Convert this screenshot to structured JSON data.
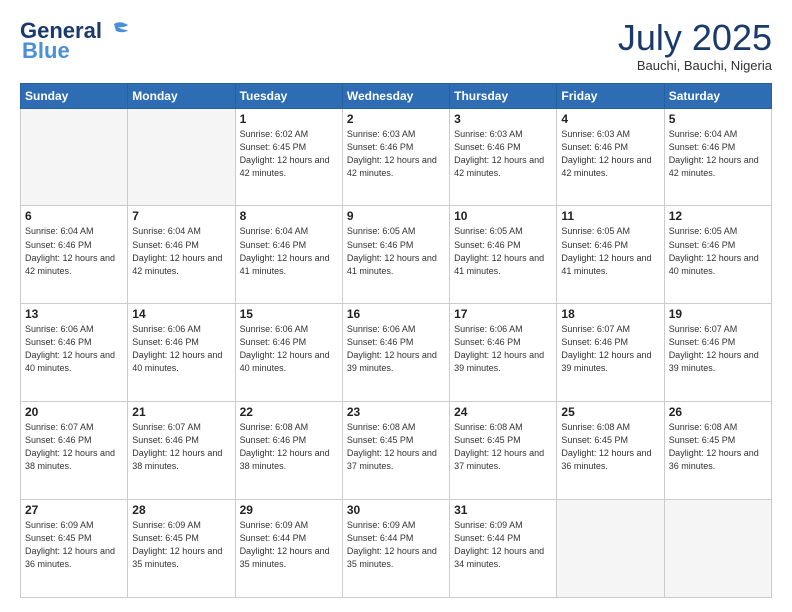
{
  "header": {
    "logo_general": "General",
    "logo_blue": "Blue",
    "month": "July 2025",
    "location": "Bauchi, Bauchi, Nigeria"
  },
  "days_of_week": [
    "Sunday",
    "Monday",
    "Tuesday",
    "Wednesday",
    "Thursday",
    "Friday",
    "Saturday"
  ],
  "weeks": [
    [
      {
        "day": "",
        "sunrise": "",
        "sunset": "",
        "daylight": ""
      },
      {
        "day": "",
        "sunrise": "",
        "sunset": "",
        "daylight": ""
      },
      {
        "day": "1",
        "sunrise": "Sunrise: 6:02 AM",
        "sunset": "Sunset: 6:45 PM",
        "daylight": "Daylight: 12 hours and 42 minutes."
      },
      {
        "day": "2",
        "sunrise": "Sunrise: 6:03 AM",
        "sunset": "Sunset: 6:46 PM",
        "daylight": "Daylight: 12 hours and 42 minutes."
      },
      {
        "day": "3",
        "sunrise": "Sunrise: 6:03 AM",
        "sunset": "Sunset: 6:46 PM",
        "daylight": "Daylight: 12 hours and 42 minutes."
      },
      {
        "day": "4",
        "sunrise": "Sunrise: 6:03 AM",
        "sunset": "Sunset: 6:46 PM",
        "daylight": "Daylight: 12 hours and 42 minutes."
      },
      {
        "day": "5",
        "sunrise": "Sunrise: 6:04 AM",
        "sunset": "Sunset: 6:46 PM",
        "daylight": "Daylight: 12 hours and 42 minutes."
      }
    ],
    [
      {
        "day": "6",
        "sunrise": "Sunrise: 6:04 AM",
        "sunset": "Sunset: 6:46 PM",
        "daylight": "Daylight: 12 hours and 42 minutes."
      },
      {
        "day": "7",
        "sunrise": "Sunrise: 6:04 AM",
        "sunset": "Sunset: 6:46 PM",
        "daylight": "Daylight: 12 hours and 42 minutes."
      },
      {
        "day": "8",
        "sunrise": "Sunrise: 6:04 AM",
        "sunset": "Sunset: 6:46 PM",
        "daylight": "Daylight: 12 hours and 41 minutes."
      },
      {
        "day": "9",
        "sunrise": "Sunrise: 6:05 AM",
        "sunset": "Sunset: 6:46 PM",
        "daylight": "Daylight: 12 hours and 41 minutes."
      },
      {
        "day": "10",
        "sunrise": "Sunrise: 6:05 AM",
        "sunset": "Sunset: 6:46 PM",
        "daylight": "Daylight: 12 hours and 41 minutes."
      },
      {
        "day": "11",
        "sunrise": "Sunrise: 6:05 AM",
        "sunset": "Sunset: 6:46 PM",
        "daylight": "Daylight: 12 hours and 41 minutes."
      },
      {
        "day": "12",
        "sunrise": "Sunrise: 6:05 AM",
        "sunset": "Sunset: 6:46 PM",
        "daylight": "Daylight: 12 hours and 40 minutes."
      }
    ],
    [
      {
        "day": "13",
        "sunrise": "Sunrise: 6:06 AM",
        "sunset": "Sunset: 6:46 PM",
        "daylight": "Daylight: 12 hours and 40 minutes."
      },
      {
        "day": "14",
        "sunrise": "Sunrise: 6:06 AM",
        "sunset": "Sunset: 6:46 PM",
        "daylight": "Daylight: 12 hours and 40 minutes."
      },
      {
        "day": "15",
        "sunrise": "Sunrise: 6:06 AM",
        "sunset": "Sunset: 6:46 PM",
        "daylight": "Daylight: 12 hours and 40 minutes."
      },
      {
        "day": "16",
        "sunrise": "Sunrise: 6:06 AM",
        "sunset": "Sunset: 6:46 PM",
        "daylight": "Daylight: 12 hours and 39 minutes."
      },
      {
        "day": "17",
        "sunrise": "Sunrise: 6:06 AM",
        "sunset": "Sunset: 6:46 PM",
        "daylight": "Daylight: 12 hours and 39 minutes."
      },
      {
        "day": "18",
        "sunrise": "Sunrise: 6:07 AM",
        "sunset": "Sunset: 6:46 PM",
        "daylight": "Daylight: 12 hours and 39 minutes."
      },
      {
        "day": "19",
        "sunrise": "Sunrise: 6:07 AM",
        "sunset": "Sunset: 6:46 PM",
        "daylight": "Daylight: 12 hours and 39 minutes."
      }
    ],
    [
      {
        "day": "20",
        "sunrise": "Sunrise: 6:07 AM",
        "sunset": "Sunset: 6:46 PM",
        "daylight": "Daylight: 12 hours and 38 minutes."
      },
      {
        "day": "21",
        "sunrise": "Sunrise: 6:07 AM",
        "sunset": "Sunset: 6:46 PM",
        "daylight": "Daylight: 12 hours and 38 minutes."
      },
      {
        "day": "22",
        "sunrise": "Sunrise: 6:08 AM",
        "sunset": "Sunset: 6:46 PM",
        "daylight": "Daylight: 12 hours and 38 minutes."
      },
      {
        "day": "23",
        "sunrise": "Sunrise: 6:08 AM",
        "sunset": "Sunset: 6:45 PM",
        "daylight": "Daylight: 12 hours and 37 minutes."
      },
      {
        "day": "24",
        "sunrise": "Sunrise: 6:08 AM",
        "sunset": "Sunset: 6:45 PM",
        "daylight": "Daylight: 12 hours and 37 minutes."
      },
      {
        "day": "25",
        "sunrise": "Sunrise: 6:08 AM",
        "sunset": "Sunset: 6:45 PM",
        "daylight": "Daylight: 12 hours and 36 minutes."
      },
      {
        "day": "26",
        "sunrise": "Sunrise: 6:08 AM",
        "sunset": "Sunset: 6:45 PM",
        "daylight": "Daylight: 12 hours and 36 minutes."
      }
    ],
    [
      {
        "day": "27",
        "sunrise": "Sunrise: 6:09 AM",
        "sunset": "Sunset: 6:45 PM",
        "daylight": "Daylight: 12 hours and 36 minutes."
      },
      {
        "day": "28",
        "sunrise": "Sunrise: 6:09 AM",
        "sunset": "Sunset: 6:45 PM",
        "daylight": "Daylight: 12 hours and 35 minutes."
      },
      {
        "day": "29",
        "sunrise": "Sunrise: 6:09 AM",
        "sunset": "Sunset: 6:44 PM",
        "daylight": "Daylight: 12 hours and 35 minutes."
      },
      {
        "day": "30",
        "sunrise": "Sunrise: 6:09 AM",
        "sunset": "Sunset: 6:44 PM",
        "daylight": "Daylight: 12 hours and 35 minutes."
      },
      {
        "day": "31",
        "sunrise": "Sunrise: 6:09 AM",
        "sunset": "Sunset: 6:44 PM",
        "daylight": "Daylight: 12 hours and 34 minutes."
      },
      {
        "day": "",
        "sunrise": "",
        "sunset": "",
        "daylight": ""
      },
      {
        "day": "",
        "sunrise": "",
        "sunset": "",
        "daylight": ""
      }
    ]
  ]
}
